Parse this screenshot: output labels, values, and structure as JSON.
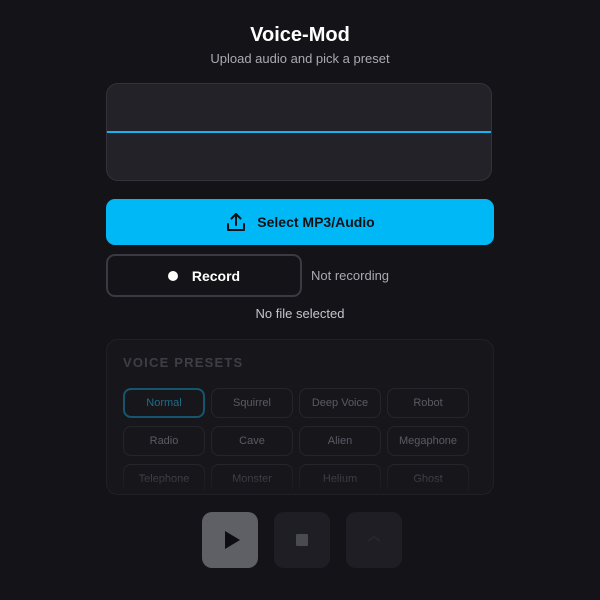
{
  "app": {
    "title": "Voice-Mod",
    "subtitle": "Upload audio and pick a preset"
  },
  "upload": {
    "button_label": "Select MP3/Audio",
    "icon": "upload-icon",
    "accent_color": "#00b8f5"
  },
  "waveform": {
    "line_color": "#17b3f0"
  },
  "record": {
    "button_label": "Record",
    "status": "Not recording"
  },
  "file": {
    "status": "No file selected"
  },
  "presets": {
    "title": "VOICE PRESETS",
    "selected": "Normal",
    "items": [
      {
        "label": "Normal"
      },
      {
        "label": "Squirrel"
      },
      {
        "label": "Deep Voice"
      },
      {
        "label": "Robot"
      },
      {
        "label": "Radio"
      },
      {
        "label": "Cave"
      },
      {
        "label": "Alien"
      },
      {
        "label": "Megaphone"
      },
      {
        "label": "Telephone"
      },
      {
        "label": "Monster"
      },
      {
        "label": "Helium"
      },
      {
        "label": "Ghost"
      }
    ]
  },
  "controls": {
    "play_icon": "play-icon",
    "stop_icon": "stop-icon",
    "download_icon": "download-icon"
  }
}
